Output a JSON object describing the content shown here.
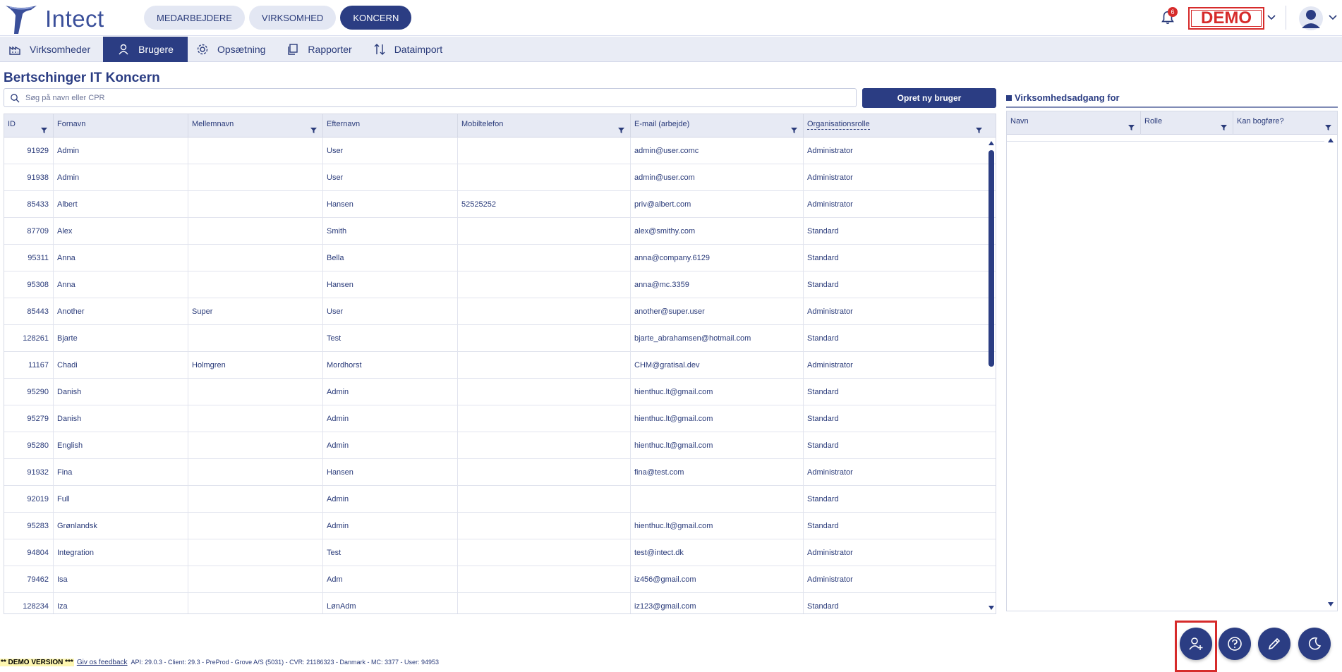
{
  "app": {
    "logo_text": "Intect",
    "top_tabs": [
      "MEDARBEJDERE",
      "VIRKSOMHED",
      "KONCERN"
    ],
    "active_top_tab": "KONCERN",
    "notifications_count": "6",
    "demo_label": "DEMO"
  },
  "subnav": {
    "items": [
      "Virksomheder",
      "Brugere",
      "Opsætning",
      "Rapporter",
      "Dataimport"
    ],
    "active": "Brugere"
  },
  "page": {
    "title": "Bertschinger IT Koncern",
    "search_placeholder": "Søg på navn eller CPR",
    "create_button": "Opret ny bruger"
  },
  "table": {
    "headers": [
      "ID",
      "Fornavn",
      "Mellemnavn",
      "Efternavn",
      "Mobiltelefon",
      "E-mail (arbejde)",
      "Organisationsrolle"
    ],
    "rows": [
      [
        "91929",
        "Admin",
        "",
        "User",
        "",
        "admin@user.comc",
        "Administrator"
      ],
      [
        "91938",
        "Admin",
        "",
        "User",
        "",
        "admin@user.com",
        "Administrator"
      ],
      [
        "85433",
        "Albert",
        "",
        "Hansen",
        "52525252",
        "priv@albert.com",
        "Administrator"
      ],
      [
        "87709",
        "Alex",
        "",
        "Smith",
        "",
        "alex@smithy.com",
        "Standard"
      ],
      [
        "95311",
        "Anna",
        "",
        "Bella",
        "",
        "anna@company.6129",
        "Standard"
      ],
      [
        "95308",
        "Anna",
        "",
        "Hansen",
        "",
        "anna@mc.3359",
        "Standard"
      ],
      [
        "85443",
        "Another",
        "Super",
        "User",
        "",
        "another@super.user",
        "Administrator"
      ],
      [
        "128261",
        "Bjarte",
        "",
        "Test",
        "",
        "bjarte_abrahamsen@hotmail.com",
        "Standard"
      ],
      [
        "11167",
        "Chadi",
        "Holmgren",
        "Mordhorst",
        "",
        "CHM@gratisal.dev",
        "Administrator"
      ],
      [
        "95290",
        "Danish",
        "",
        "Admin",
        "",
        "hienthuc.lt@gmail.com",
        "Standard"
      ],
      [
        "95279",
        "Danish",
        "",
        "Admin",
        "",
        "hienthuc.lt@gmail.com",
        "Standard"
      ],
      [
        "95280",
        "English",
        "",
        "Admin",
        "",
        "hienthuc.lt@gmail.com",
        "Standard"
      ],
      [
        "91932",
        "Fina",
        "",
        "Hansen",
        "",
        "fina@test.com",
        "Administrator"
      ],
      [
        "92019",
        "Full",
        "",
        "Admin",
        "",
        "",
        "Standard"
      ],
      [
        "95283",
        "Grønlandsk",
        "",
        "Admin",
        "",
        "hienthuc.lt@gmail.com",
        "Standard"
      ],
      [
        "94804",
        "Integration",
        "",
        "Test",
        "",
        "test@intect.dk",
        "Administrator"
      ],
      [
        "79462",
        "Isa",
        "",
        "Adm",
        "",
        "iz456@gmail.com",
        "Administrator"
      ],
      [
        "128234",
        "Iza",
        "",
        "LønAdm",
        "",
        "iz123@gmail.com",
        "Standard"
      ]
    ]
  },
  "panel": {
    "title": "Virksomhedsadgang for",
    "headers": [
      "Navn",
      "Rolle",
      "Kan bogføre?"
    ]
  },
  "footer": {
    "demo_version": "** DEMO VERSION ***",
    "feedback": "Giv os feedback",
    "info": "API: 29.0.3 - Client: 29.3 - PreProd - Grove A/S (5031) - CVR: 21186323 - Danmark - MC: 3377 - User: 94953"
  },
  "icons": {
    "top": [
      "intect-logo-icon",
      "bell-icon",
      "chevron-down-icon",
      "user-avatar-icon"
    ],
    "subnav": [
      "factory-icon",
      "user-icon",
      "gear-icon",
      "copy-icon",
      "sort-arrows-icon"
    ],
    "fabs": [
      "add-user-icon",
      "help-icon",
      "edit-icon",
      "moon-icon"
    ]
  },
  "colors": {
    "primary": "#2b3d83",
    "demo_red": "#d62b2b",
    "light_bg": "#e9ecf5"
  }
}
